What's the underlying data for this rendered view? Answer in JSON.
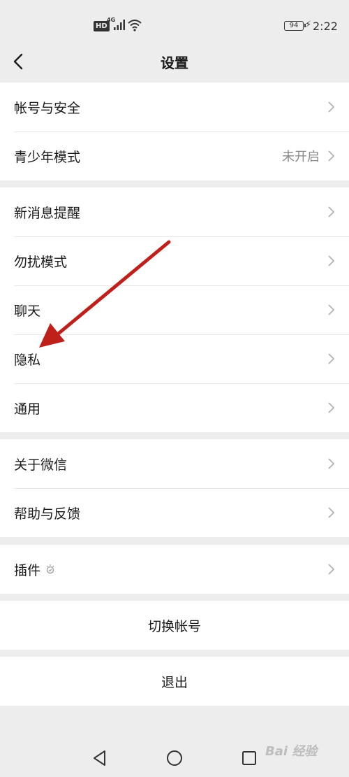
{
  "status_bar": {
    "hd": "HD",
    "network": "4G",
    "battery": "94",
    "time": "2:22"
  },
  "nav": {
    "title": "设置",
    "back_icon": "chevron-left-icon"
  },
  "groups": [
    {
      "items": [
        {
          "label": "帐号与安全"
        },
        {
          "label": "青少年模式",
          "value": "未开启"
        }
      ]
    },
    {
      "items": [
        {
          "label": "新消息提醒"
        },
        {
          "label": "勿扰模式"
        },
        {
          "label": "聊天"
        },
        {
          "label": "隐私"
        },
        {
          "label": "通用"
        }
      ]
    },
    {
      "items": [
        {
          "label": "关于微信"
        },
        {
          "label": "帮助与反馈"
        }
      ]
    },
    {
      "items": [
        {
          "label": "插件",
          "icon": "plugin-icon"
        }
      ]
    }
  ],
  "actions": {
    "switch_account": "切换帐号",
    "logout": "退出"
  },
  "annotation": {
    "color": "#c0201a"
  },
  "watermark": "Bai 经验",
  "colors": {
    "background": "#ededed",
    "card": "#ffffff",
    "text": "#1a1a1a",
    "secondary": "#8a8a8a",
    "chevron": "#b2b2b2"
  }
}
